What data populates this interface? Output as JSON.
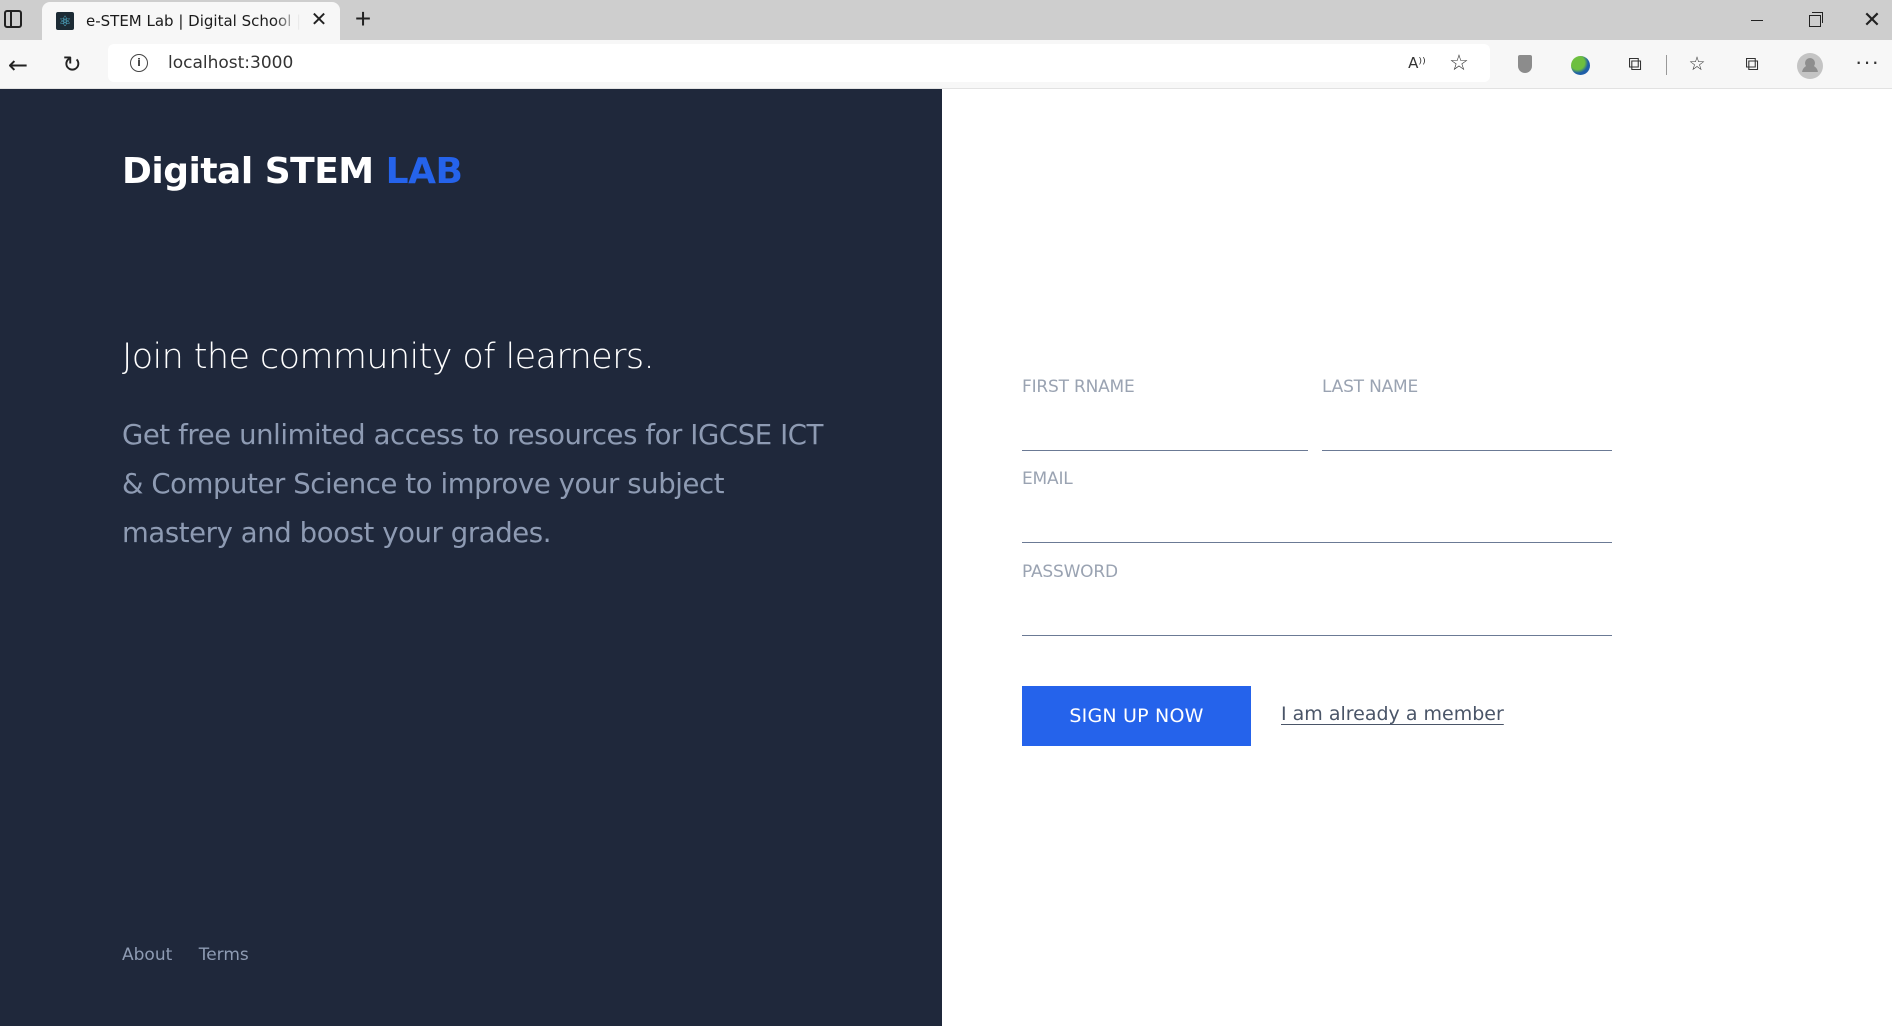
{
  "browser": {
    "tab_title": "e-STEM Lab | Digital School | Science",
    "tab_close": "✕",
    "new_tab": "+",
    "url": "localhost:3000",
    "read_aloud": "A⁾⁾",
    "icons": {
      "tab_actions": "tab-actions-icon",
      "favicon": "react-atom-icon",
      "back": "back-arrow-icon",
      "reload": "reload-icon",
      "site_info": "info-icon",
      "read_aloud": "read-aloud-icon",
      "add_favorite": "star-add-icon",
      "tracking": "shield-icon",
      "extension_globe": "globe-icon",
      "extensions": "puzzle-icon",
      "favorites": "favorites-icon",
      "collections": "collections-icon",
      "profile": "profile-icon",
      "more": "more-icon"
    }
  },
  "left_panel": {
    "brand_main": "Digital STEM ",
    "brand_accent": "LAB",
    "headline": "Join the community of learners.",
    "description": "Get free unlimited access to resources for IGCSE ICT & Computer Science to improve your subject mastery and boost your grades.",
    "footer_links": [
      "About",
      "Terms"
    ]
  },
  "form": {
    "first_name_label": "FIRST RNAME",
    "first_name_value": "",
    "last_name_label": "LAST NAME",
    "last_name_value": "",
    "email_label": "EMAIL",
    "email_value": "",
    "password_label": "PASSWORD",
    "password_value": "",
    "submit_label": "SIGN UP NOW",
    "member_link": "I am already a member"
  },
  "colors": {
    "left_bg": "#1f283b",
    "accent": "#2563eb",
    "muted_text": "#8e9bb3",
    "label_text": "#9aa3b2"
  }
}
